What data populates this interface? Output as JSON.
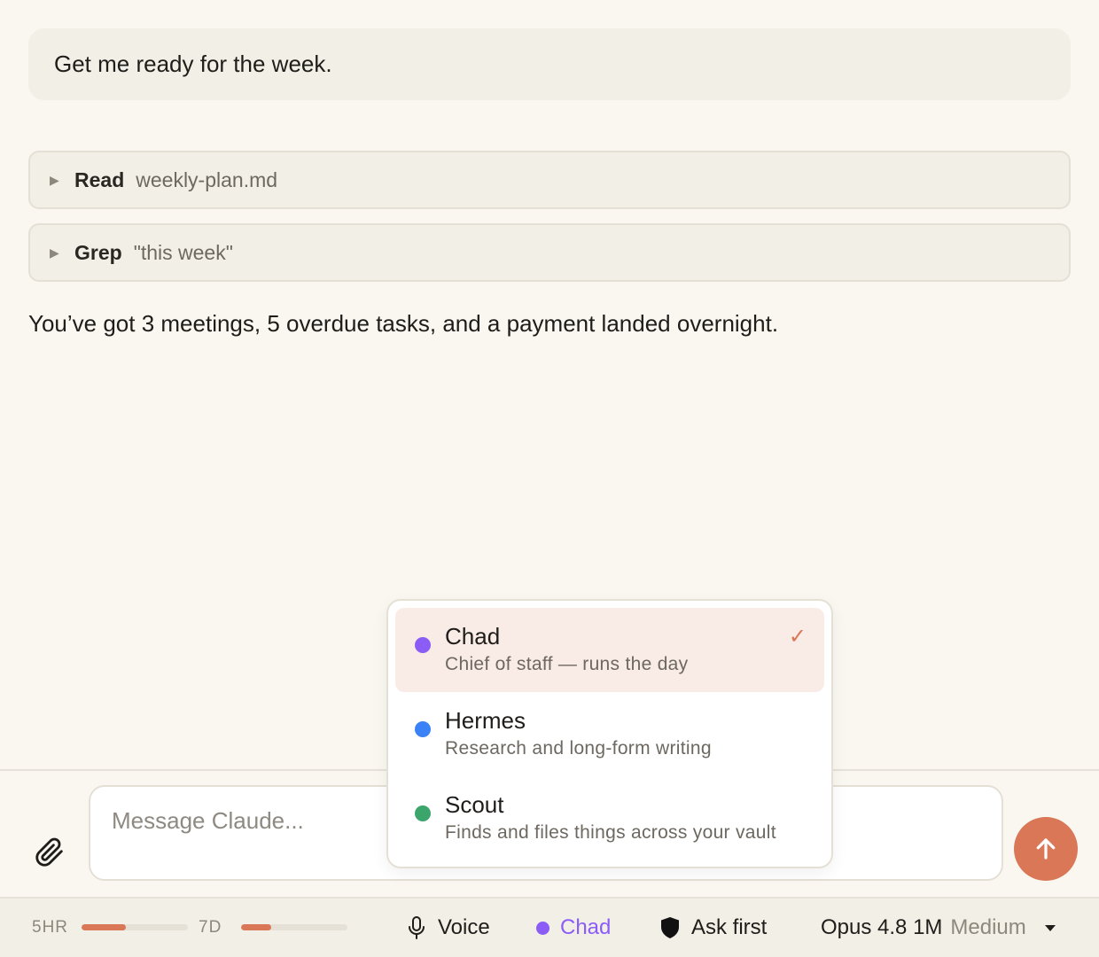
{
  "conversation": {
    "user_message": "Get me ready for the week.",
    "tool_calls": [
      {
        "verb": "Read",
        "arg": "weekly-plan.md"
      },
      {
        "verb": "Grep",
        "arg": "\"this week\""
      }
    ],
    "assistant_reply": "You’ve got 3 meetings, 5 overdue tasks, and a payment landed overnight."
  },
  "composer": {
    "placeholder": "Message Claude..."
  },
  "agent_menu": {
    "items": [
      {
        "name": "Chad",
        "description": "Chief of staff — runs the day",
        "color": "#8b5cf6",
        "selected": true
      },
      {
        "name": "Hermes",
        "description": "Research and long-form writing",
        "color": "#3b82f6",
        "selected": false
      },
      {
        "name": "Scout",
        "description": "Finds and files things across your vault",
        "color": "#3ba56b",
        "selected": false
      }
    ],
    "check_glyph": "✓"
  },
  "status_bar": {
    "usage": [
      {
        "label": "5HR",
        "fraction": 0.42
      },
      {
        "label": "7D",
        "fraction": 0.28
      }
    ],
    "voice_label": "Voice",
    "agent_label": "Chad",
    "agent_color": "#8b5cf6",
    "permission_label": "Ask first",
    "model_label": "Opus 4.8 1M",
    "effort_label": "Medium"
  },
  "colors": {
    "accent": "#d97757",
    "background": "#faf7f1",
    "panel": "#f2efe7"
  },
  "icons": {
    "attach": "paperclip-icon",
    "send": "arrow-up-icon",
    "voice": "microphone-icon",
    "permission": "shield-icon",
    "model": "caret-down-icon",
    "expand": "triangle-right-icon"
  }
}
